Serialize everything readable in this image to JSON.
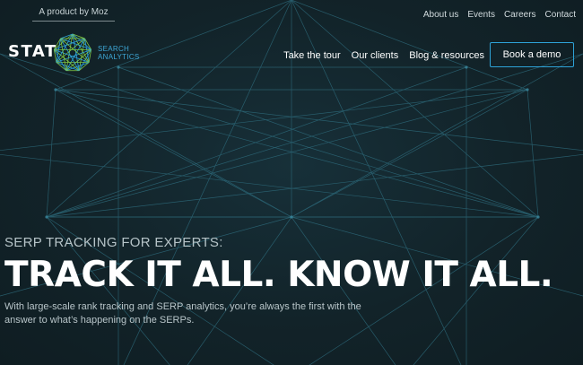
{
  "topbar": {
    "tagline": "A product by Moz",
    "links": [
      {
        "label": "About us"
      },
      {
        "label": "Events"
      },
      {
        "label": "Careers"
      },
      {
        "label": "Contact"
      }
    ]
  },
  "logo": {
    "wordmark": "STAT",
    "sub_line1": "SEARCH",
    "sub_line2": "ANALYTICS"
  },
  "nav": {
    "items": [
      {
        "label": "Take the tour"
      },
      {
        "label": "Our clients"
      },
      {
        "label": "Blog & resources"
      }
    ],
    "cta_label": "Book a demo"
  },
  "hero": {
    "eyebrow": "SERP TRACKING FOR EXPERTS:",
    "headline": "TRACK IT ALL. KNOW IT ALL.",
    "subtext": "With large-scale rank tracking and SERP analytics, you’re always the first with the answer to what’s happening on the SERPs."
  },
  "colors": {
    "background": "#122329",
    "accent": "#2ea3d8",
    "logo_green": "#7ec544",
    "line": "#2f6f80"
  },
  "icons": {
    "logo_mark": "geometric-polygon-icon",
    "background": "wireframe-polygon-pattern"
  }
}
